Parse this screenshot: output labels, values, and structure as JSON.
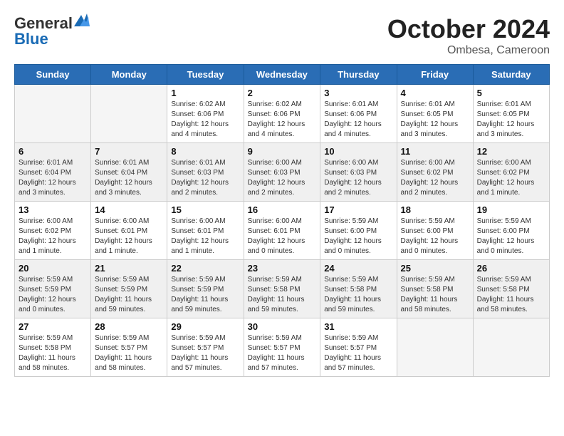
{
  "header": {
    "logo": {
      "general": "General",
      "blue": "Blue"
    },
    "title": "October 2024",
    "subtitle": "Ombesa, Cameroon"
  },
  "weekdays": [
    "Sunday",
    "Monday",
    "Tuesday",
    "Wednesday",
    "Thursday",
    "Friday",
    "Saturday"
  ],
  "weeks": [
    [
      {
        "day": "",
        "info": ""
      },
      {
        "day": "",
        "info": ""
      },
      {
        "day": "1",
        "info": "Sunrise: 6:02 AM\nSunset: 6:06 PM\nDaylight: 12 hours\nand 4 minutes."
      },
      {
        "day": "2",
        "info": "Sunrise: 6:02 AM\nSunset: 6:06 PM\nDaylight: 12 hours\nand 4 minutes."
      },
      {
        "day": "3",
        "info": "Sunrise: 6:01 AM\nSunset: 6:06 PM\nDaylight: 12 hours\nand 4 minutes."
      },
      {
        "day": "4",
        "info": "Sunrise: 6:01 AM\nSunset: 6:05 PM\nDaylight: 12 hours\nand 3 minutes."
      },
      {
        "day": "5",
        "info": "Sunrise: 6:01 AM\nSunset: 6:05 PM\nDaylight: 12 hours\nand 3 minutes."
      }
    ],
    [
      {
        "day": "6",
        "info": "Sunrise: 6:01 AM\nSunset: 6:04 PM\nDaylight: 12 hours\nand 3 minutes."
      },
      {
        "day": "7",
        "info": "Sunrise: 6:01 AM\nSunset: 6:04 PM\nDaylight: 12 hours\nand 3 minutes."
      },
      {
        "day": "8",
        "info": "Sunrise: 6:01 AM\nSunset: 6:03 PM\nDaylight: 12 hours\nand 2 minutes."
      },
      {
        "day": "9",
        "info": "Sunrise: 6:00 AM\nSunset: 6:03 PM\nDaylight: 12 hours\nand 2 minutes."
      },
      {
        "day": "10",
        "info": "Sunrise: 6:00 AM\nSunset: 6:03 PM\nDaylight: 12 hours\nand 2 minutes."
      },
      {
        "day": "11",
        "info": "Sunrise: 6:00 AM\nSunset: 6:02 PM\nDaylight: 12 hours\nand 2 minutes."
      },
      {
        "day": "12",
        "info": "Sunrise: 6:00 AM\nSunset: 6:02 PM\nDaylight: 12 hours\nand 1 minute."
      }
    ],
    [
      {
        "day": "13",
        "info": "Sunrise: 6:00 AM\nSunset: 6:02 PM\nDaylight: 12 hours\nand 1 minute."
      },
      {
        "day": "14",
        "info": "Sunrise: 6:00 AM\nSunset: 6:01 PM\nDaylight: 12 hours\nand 1 minute."
      },
      {
        "day": "15",
        "info": "Sunrise: 6:00 AM\nSunset: 6:01 PM\nDaylight: 12 hours\nand 1 minute."
      },
      {
        "day": "16",
        "info": "Sunrise: 6:00 AM\nSunset: 6:01 PM\nDaylight: 12 hours\nand 0 minutes."
      },
      {
        "day": "17",
        "info": "Sunrise: 5:59 AM\nSunset: 6:00 PM\nDaylight: 12 hours\nand 0 minutes."
      },
      {
        "day": "18",
        "info": "Sunrise: 5:59 AM\nSunset: 6:00 PM\nDaylight: 12 hours\nand 0 minutes."
      },
      {
        "day": "19",
        "info": "Sunrise: 5:59 AM\nSunset: 6:00 PM\nDaylight: 12 hours\nand 0 minutes."
      }
    ],
    [
      {
        "day": "20",
        "info": "Sunrise: 5:59 AM\nSunset: 5:59 PM\nDaylight: 12 hours\nand 0 minutes."
      },
      {
        "day": "21",
        "info": "Sunrise: 5:59 AM\nSunset: 5:59 PM\nDaylight: 11 hours\nand 59 minutes."
      },
      {
        "day": "22",
        "info": "Sunrise: 5:59 AM\nSunset: 5:59 PM\nDaylight: 11 hours\nand 59 minutes."
      },
      {
        "day": "23",
        "info": "Sunrise: 5:59 AM\nSunset: 5:58 PM\nDaylight: 11 hours\nand 59 minutes."
      },
      {
        "day": "24",
        "info": "Sunrise: 5:59 AM\nSunset: 5:58 PM\nDaylight: 11 hours\nand 59 minutes."
      },
      {
        "day": "25",
        "info": "Sunrise: 5:59 AM\nSunset: 5:58 PM\nDaylight: 11 hours\nand 58 minutes."
      },
      {
        "day": "26",
        "info": "Sunrise: 5:59 AM\nSunset: 5:58 PM\nDaylight: 11 hours\nand 58 minutes."
      }
    ],
    [
      {
        "day": "27",
        "info": "Sunrise: 5:59 AM\nSunset: 5:58 PM\nDaylight: 11 hours\nand 58 minutes."
      },
      {
        "day": "28",
        "info": "Sunrise: 5:59 AM\nSunset: 5:57 PM\nDaylight: 11 hours\nand 58 minutes."
      },
      {
        "day": "29",
        "info": "Sunrise: 5:59 AM\nSunset: 5:57 PM\nDaylight: 11 hours\nand 57 minutes."
      },
      {
        "day": "30",
        "info": "Sunrise: 5:59 AM\nSunset: 5:57 PM\nDaylight: 11 hours\nand 57 minutes."
      },
      {
        "day": "31",
        "info": "Sunrise: 5:59 AM\nSunset: 5:57 PM\nDaylight: 11 hours\nand 57 minutes."
      },
      {
        "day": "",
        "info": ""
      },
      {
        "day": "",
        "info": ""
      }
    ]
  ]
}
